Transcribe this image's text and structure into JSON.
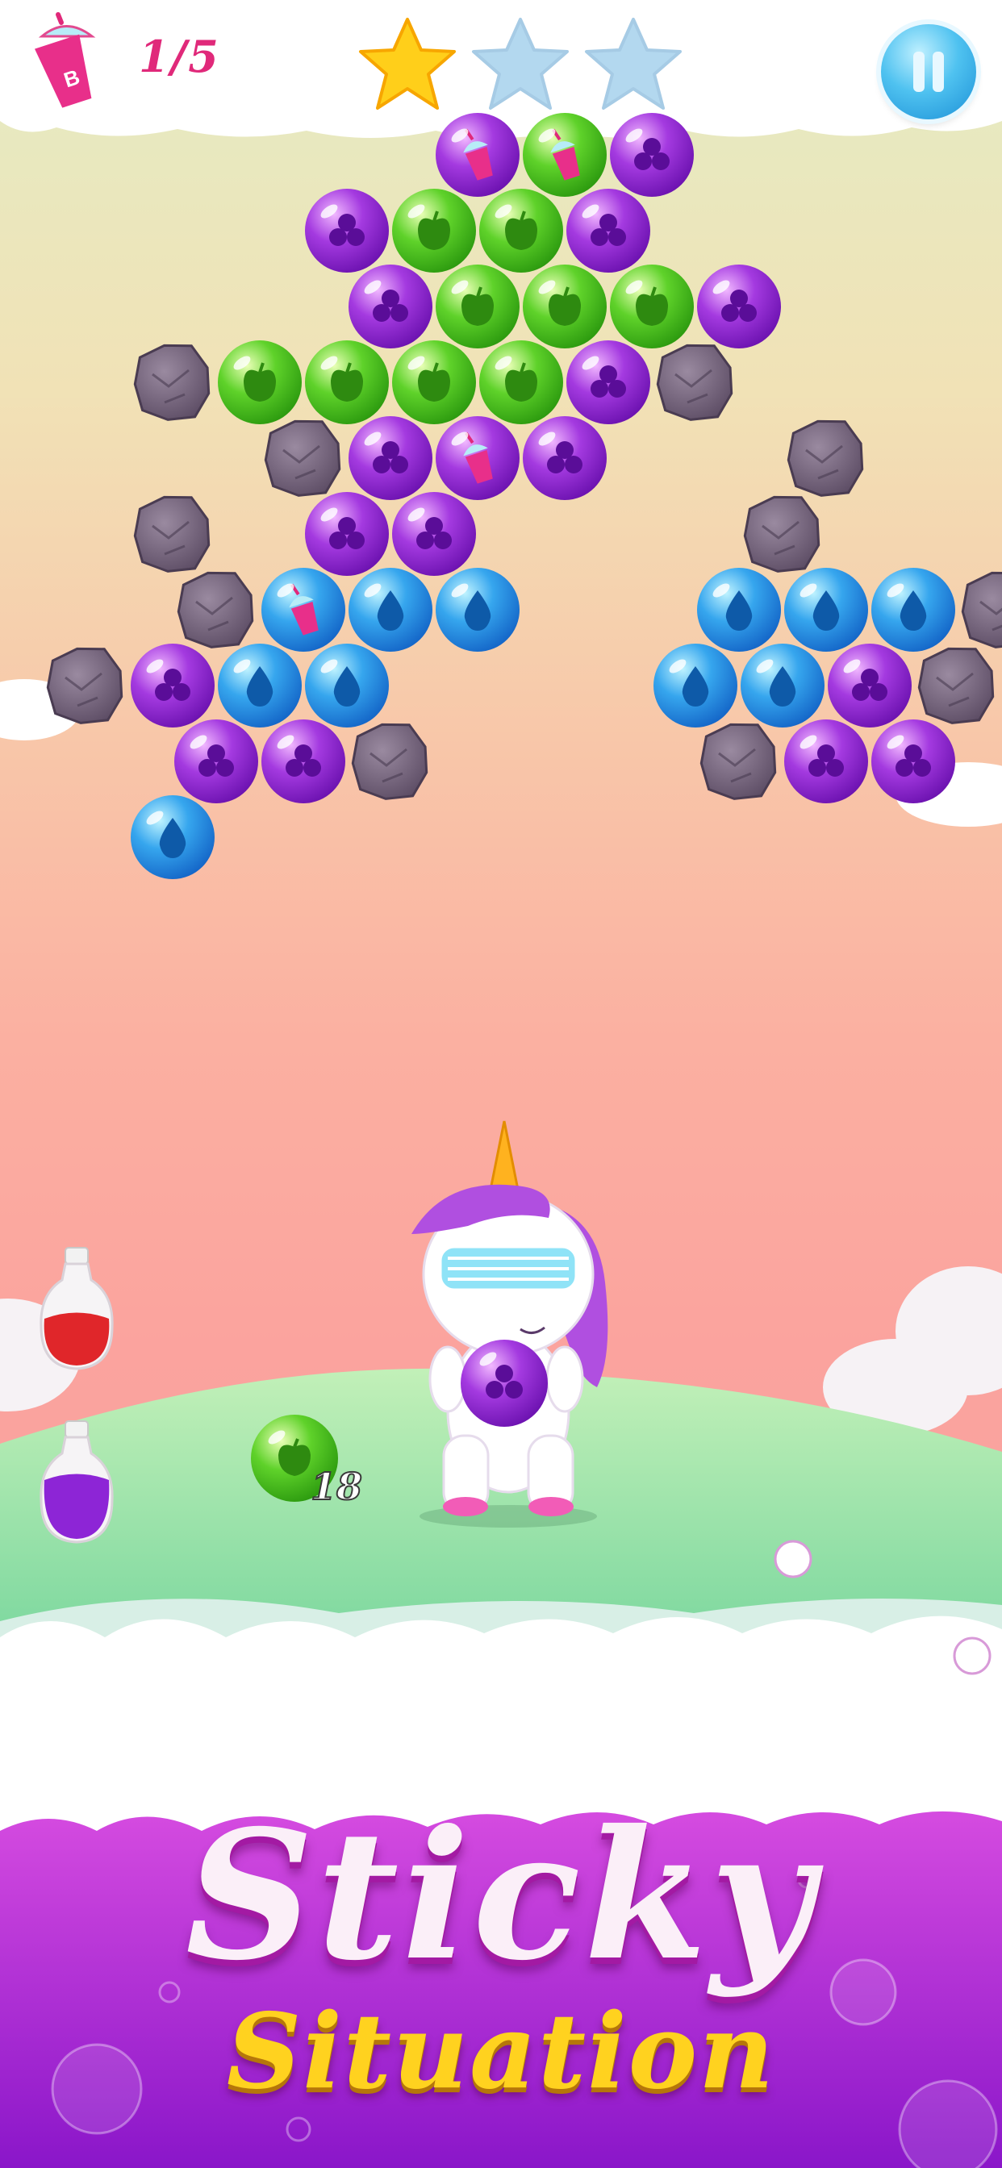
{
  "hud": {
    "objective_count": "1/5",
    "objective_icon": "milkshake-cup-icon",
    "stars_earned": 1,
    "stars_total": 3,
    "pause_icon": "pause-icon"
  },
  "shooter": {
    "current_bubble": "purple",
    "next_bubble": "green",
    "shots_remaining": "18"
  },
  "boosters": [
    {
      "name": "red-potion",
      "color": "#e0262a"
    },
    {
      "name": "purple-potion",
      "color": "#8d25d6"
    }
  ],
  "board": {
    "legend": {
      "P": "purple",
      "G": "green",
      "B": "blue",
      "R": "rock"
    },
    "rows": [
      {
        "offset": false,
        "cells": "....PGP...."
      },
      {
        "offset": true,
        "cells": "...PGGP...."
      },
      {
        "offset": false,
        "cells": "...PGGGP..."
      },
      {
        "offset": true,
        "cells": ".RGGGGPR..."
      },
      {
        "offset": false,
        "cells": "..RPPP..R.."
      },
      {
        "offset": true,
        "cells": ".R.PP...R.."
      },
      {
        "offset": false,
        "cells": ".RBBB..BBBR"
      },
      {
        "offset": true,
        "cells": "RPBB...BBPR"
      },
      {
        "offset": false,
        "cells": ".PPR...RPP."
      },
      {
        "offset": true,
        "cells": ".B........."
      }
    ],
    "collectibles": [
      {
        "row": 0,
        "col": 4
      },
      {
        "row": 0,
        "col": 5
      },
      {
        "row": 4,
        "col": 4
      },
      {
        "row": 6,
        "col": 2
      }
    ]
  },
  "colors": {
    "purple": "#8b1fd2",
    "green": "#46c21a",
    "blue": "#1f8ee6",
    "rock": "#6b5a70",
    "accent_pink": "#e0297a",
    "title_yellow": "#ffd21f"
  },
  "title": {
    "line1": "Sticky",
    "line2": "Situation"
  }
}
